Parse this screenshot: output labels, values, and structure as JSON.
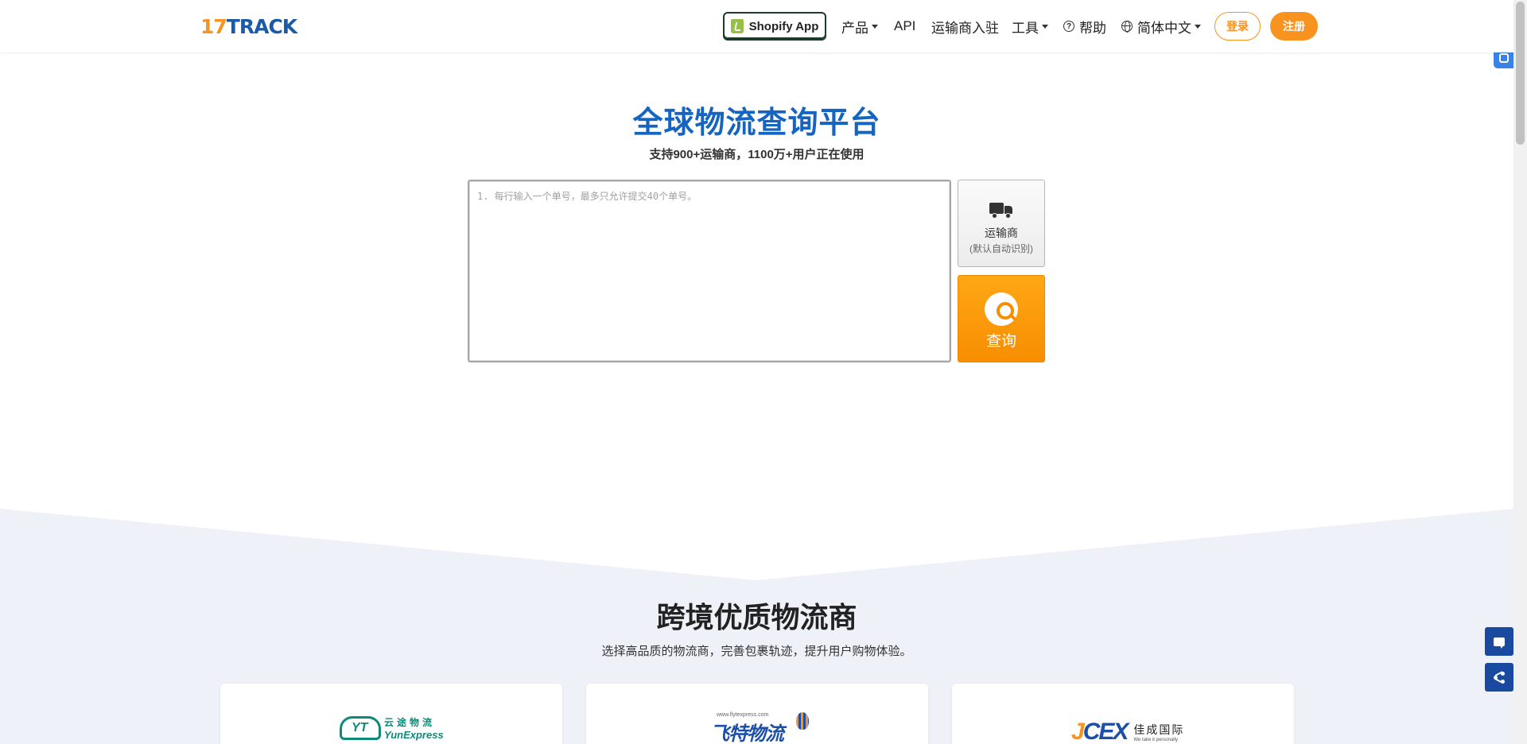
{
  "header": {
    "logo_num": "17",
    "logo_text": "TRACK",
    "shopify_label": "Shopify App",
    "nav": {
      "products": "产品",
      "api": "API",
      "carrier_join": "运输商入驻",
      "tools": "工具",
      "help": "帮助",
      "language": "简体中文"
    },
    "login_label": "登录",
    "register_label": "注册"
  },
  "hero": {
    "title": "全球物流查询平台",
    "subtitle": "支持900+运输商，1100万+用户正在使用",
    "input_placeholder": "1. 每行输入一个单号，最多只允许提交40个单号。",
    "carrier_label": "运输商",
    "carrier_hint": "(默认自动识别)",
    "query_label": "查询"
  },
  "partners": {
    "title": "跨境优质物流商",
    "subtitle": "选择高品质的物流商，完善包裹轨迹，提升用户购物体验。",
    "cards": [
      {
        "cn": "云途物流",
        "en": "YunExpress"
      },
      {
        "url": "www.flytexpress.com",
        "cn": "飞特物流"
      },
      {
        "brand": "JCEX",
        "cn": "佳成国际",
        "en": "We take it personally"
      }
    ]
  },
  "colors": {
    "brand_orange": "#f7931e",
    "brand_blue": "#1565c0",
    "float_blue": "#1a4aa0",
    "section_bg": "#eef1f8"
  },
  "icons": [
    "shopify-icon",
    "caret-down-icon",
    "help-icon",
    "globe-icon",
    "truck-icon",
    "search-icon",
    "chat-icon",
    "share-icon",
    "translate-icon"
  ]
}
